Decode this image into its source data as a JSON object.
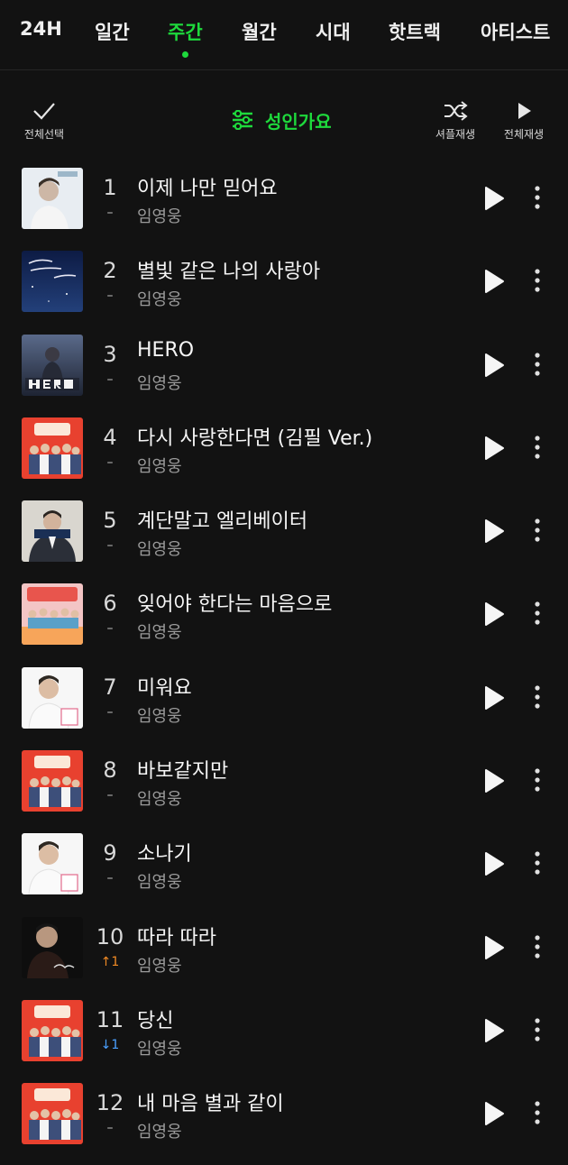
{
  "tabs": [
    {
      "label": "24H",
      "active": false
    },
    {
      "label": "일간",
      "active": false
    },
    {
      "label": "주간",
      "active": true
    },
    {
      "label": "월간",
      "active": false
    },
    {
      "label": "시대",
      "active": false
    },
    {
      "label": "핫트랙",
      "active": false
    },
    {
      "label": "아티스트",
      "active": false
    }
  ],
  "toolbar": {
    "select_all_label": "전체선택",
    "genre_label": "성인가요",
    "shuffle_label": "셔플재생",
    "play_all_label": "전체재생"
  },
  "colors": {
    "accent": "#1ed93c",
    "background": "#121212",
    "rank_up": "#f08a24",
    "rank_down": "#4aa0ff"
  },
  "tracks": [
    {
      "rank": "1",
      "change": "–",
      "change_type": "same",
      "title": "이제 나만 믿어요",
      "artist": "임영웅",
      "art": "portrait-light"
    },
    {
      "rank": "2",
      "change": "–",
      "change_type": "same",
      "title": "별빛 같은 나의 사랑아",
      "artist": "임영웅",
      "art": "night-sky"
    },
    {
      "rank": "3",
      "change": "–",
      "change_type": "same",
      "title": "HERO",
      "artist": "임영웅",
      "art": "hero"
    },
    {
      "rank": "4",
      "change": "–",
      "change_type": "same",
      "title": "다시 사랑한다면 (김필 Ver.)",
      "artist": "임영웅",
      "art": "red-group"
    },
    {
      "rank": "5",
      "change": "–",
      "change_type": "same",
      "title": "계단말고 엘리베이터",
      "artist": "임영웅",
      "art": "suit"
    },
    {
      "rank": "6",
      "change": "–",
      "change_type": "same",
      "title": "잊어야 한다는 마음으로",
      "artist": "임영웅",
      "art": "pink-group"
    },
    {
      "rank": "7",
      "change": "–",
      "change_type": "same",
      "title": "미워요",
      "artist": "임영웅",
      "art": "portrait-white"
    },
    {
      "rank": "8",
      "change": "–",
      "change_type": "same",
      "title": "바보같지만",
      "artist": "임영웅",
      "art": "red-group"
    },
    {
      "rank": "9",
      "change": "–",
      "change_type": "same",
      "title": "소나기",
      "artist": "임영웅",
      "art": "portrait-white"
    },
    {
      "rank": "10",
      "change": "↑1",
      "change_type": "up",
      "title": "따라 따라",
      "artist": "임영웅",
      "art": "dark-portrait"
    },
    {
      "rank": "11",
      "change": "↓1",
      "change_type": "down",
      "title": "당신",
      "artist": "임영웅",
      "art": "red-group"
    },
    {
      "rank": "12",
      "change": "–",
      "change_type": "same",
      "title": "내 마음 별과 같이",
      "artist": "임영웅",
      "art": "red-group"
    }
  ]
}
